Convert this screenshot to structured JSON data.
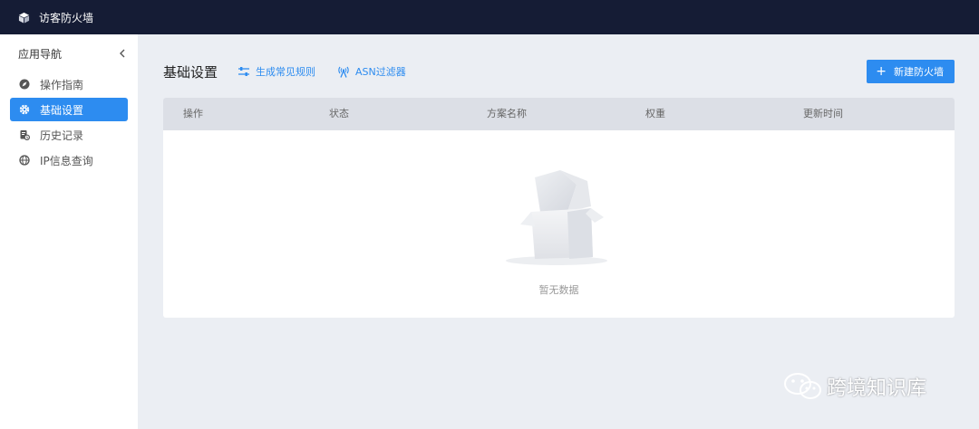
{
  "app": {
    "title": "访客防火墙"
  },
  "sidebar": {
    "heading": "应用导航",
    "items": [
      {
        "label": "操作指南",
        "icon": "compass-icon",
        "active": false
      },
      {
        "label": "基础设置",
        "icon": "gear-icon",
        "active": true
      },
      {
        "label": "历史记录",
        "icon": "history-doc-icon",
        "active": false
      },
      {
        "label": "IP信息查询",
        "icon": "globe-icon",
        "active": false
      }
    ]
  },
  "main": {
    "title": "基础设置",
    "links": [
      {
        "label": "生成常见规则",
        "icon": "sliders-icon"
      },
      {
        "label": "ASN过滤器",
        "icon": "antenna-icon"
      }
    ],
    "new_button": {
      "label": "新建防火墙",
      "icon": "plus-icon"
    }
  },
  "table": {
    "columns": [
      "操作",
      "状态",
      "方案名称",
      "权重",
      "更新时间"
    ],
    "rows": [],
    "empty_text": "暂无数据"
  },
  "watermark": {
    "text": "跨境知识库",
    "icon": "wechat-icon"
  },
  "colors": {
    "topbar": "#151c35",
    "accent": "#2d8cf0",
    "background": "#ebeef3",
    "table_header": "#dcdfe6"
  }
}
